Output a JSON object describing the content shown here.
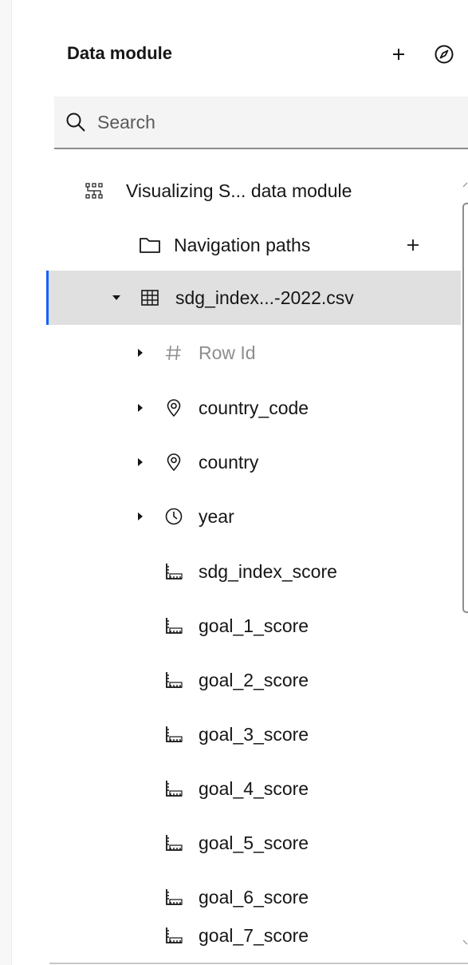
{
  "panel": {
    "title": "Data module"
  },
  "search": {
    "placeholder": "Search"
  },
  "tree": {
    "module_label": "Visualizing S... data module",
    "nav_paths_label": "Navigation paths",
    "table_label": "sdg_index...-2022.csv",
    "columns": [
      {
        "label": "Row Id",
        "icon": "hash-icon",
        "expandable": true,
        "muted": true
      },
      {
        "label": "country_code",
        "icon": "location-pin-icon",
        "expandable": true
      },
      {
        "label": "country",
        "icon": "location-pin-icon",
        "expandable": true
      },
      {
        "label": "year",
        "icon": "clock-icon",
        "expandable": true
      },
      {
        "label": "sdg_index_score",
        "icon": "measure-ruler-icon"
      },
      {
        "label": "goal_1_score",
        "icon": "measure-ruler-icon"
      },
      {
        "label": "goal_2_score",
        "icon": "measure-ruler-icon"
      },
      {
        "label": "goal_3_score",
        "icon": "measure-ruler-icon"
      },
      {
        "label": "goal_4_score",
        "icon": "measure-ruler-icon"
      },
      {
        "label": "goal_5_score",
        "icon": "measure-ruler-icon"
      },
      {
        "label": "goal_6_score",
        "icon": "measure-ruler-icon"
      },
      {
        "label": "goal_7_score",
        "icon": "measure-ruler-icon"
      }
    ]
  },
  "colors": {
    "accent": "#0f62fe",
    "selected_bg": "#e0e0e0",
    "muted_text": "#8d8d8d"
  }
}
